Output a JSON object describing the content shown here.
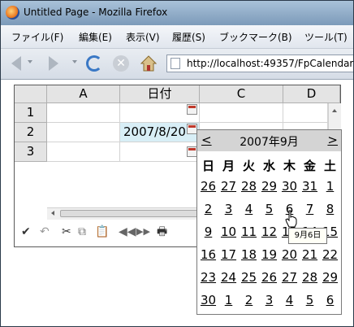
{
  "window": {
    "title": "Untitled Page - Mozilla Firefox"
  },
  "menu": {
    "items": [
      {
        "label": "ファイル(F)"
      },
      {
        "label": "編集(E)"
      },
      {
        "label": "表示(V)"
      },
      {
        "label": "履歴(S)"
      },
      {
        "label": "ブックマーク(B)"
      },
      {
        "label": "ツール(T)"
      }
    ]
  },
  "nav": {
    "url": "http://localhost:49357/FpCalendar/"
  },
  "sheet": {
    "columns": [
      "A",
      "日付",
      "C",
      "D"
    ],
    "rows": [
      "1",
      "2",
      "3"
    ],
    "cell_b2": "2007/8/20"
  },
  "calendar": {
    "prev": "<",
    "next": ">",
    "month_label": "2007年9月",
    "weekdays": [
      "日",
      "月",
      "火",
      "水",
      "木",
      "金",
      "土"
    ],
    "weeks": [
      [
        "26",
        "27",
        "28",
        "29",
        "30",
        "31",
        "1"
      ],
      [
        "2",
        "3",
        "4",
        "5",
        "6",
        "7",
        "8"
      ],
      [
        "9",
        "10",
        "11",
        "12",
        "13",
        "14",
        "15"
      ],
      [
        "16",
        "17",
        "18",
        "19",
        "20",
        "21",
        "22"
      ],
      [
        "23",
        "24",
        "25",
        "26",
        "27",
        "28",
        "29"
      ],
      [
        "30",
        "1",
        "2",
        "3",
        "4",
        "5",
        "6"
      ]
    ],
    "tooltip": "9月6日"
  },
  "toolbar": {
    "icons": [
      "check-icon",
      "undo-icon",
      "cut-icon",
      "copy-icon",
      "paste-icon",
      "prev-page-icon",
      "next-page-icon",
      "print-icon"
    ]
  }
}
